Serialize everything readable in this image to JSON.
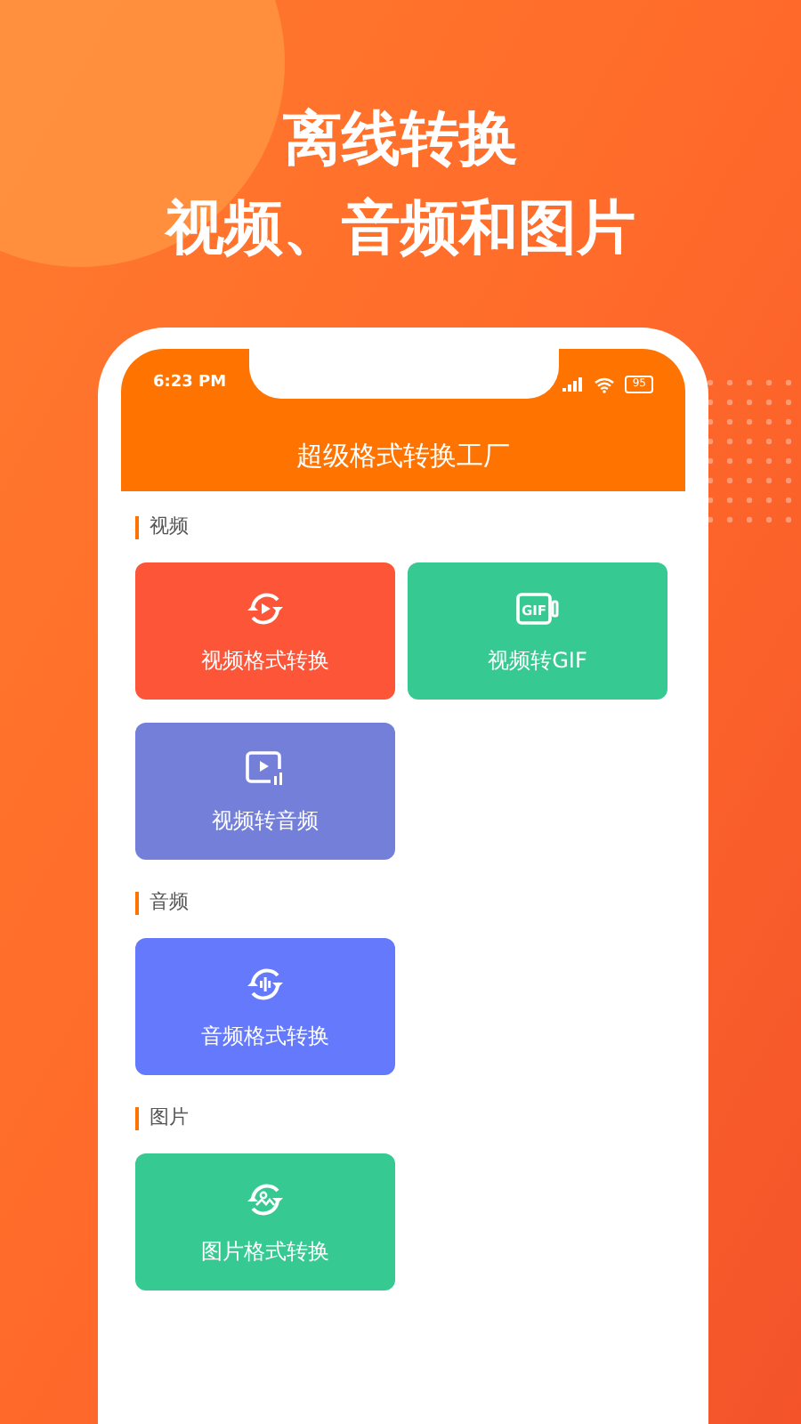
{
  "headline": [
    "离线转换",
    "视频、音频和图片"
  ],
  "status_bar": {
    "time": "6:23 PM",
    "battery": "95"
  },
  "app_title": "超级格式转换工厂",
  "sections": [
    {
      "title": "视频",
      "cards": [
        {
          "label": "视频格式转换",
          "kind": "video-convert",
          "color": "#fd5538"
        },
        {
          "label": "视频转GIF",
          "kind": "gif",
          "color": "#36c991",
          "icon_text": "GIF"
        },
        {
          "label": "视频转音频",
          "kind": "video-audio",
          "color": "#737fd8"
        }
      ]
    },
    {
      "title": "音频",
      "cards": [
        {
          "label": "音频格式转换",
          "kind": "audio-convert",
          "color": "#6479fb"
        }
      ]
    },
    {
      "title": "图片",
      "cards": [
        {
          "label": "图片格式转换",
          "kind": "image-convert",
          "color": "#36c991"
        }
      ]
    }
  ]
}
